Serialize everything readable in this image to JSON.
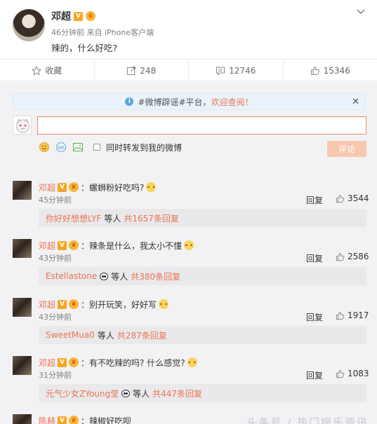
{
  "post": {
    "author": "邓超",
    "meta": "46分钟前 来自 iPhone客户端",
    "text": "辣的，什么好吃?"
  },
  "actions": {
    "favorite_label": "收藏",
    "repost_count": "248",
    "comment_count": "12746",
    "like_count": "15346"
  },
  "notice": {
    "text": "#微博辟谣#平台，",
    "link": "欢迎查阅！"
  },
  "composer": {
    "checkbox_label": "同时转发到我的微博",
    "submit_label": "评论"
  },
  "comments": [
    {
      "author": "邓超",
      "text": "：螺蛳粉好吃吗?",
      "time": "45分钟前",
      "reply_label": "回复",
      "likes": "3544",
      "sub_name": "你好好想想LYF",
      "sub_mid": "等人",
      "sub_count": "共1657条回复",
      "panda": false
    },
    {
      "author": "邓超",
      "text": "：辣条是什么，我太小不懂",
      "time": "43分钟前",
      "reply_label": "回复",
      "likes": "2586",
      "sub_name": "Estellastone",
      "sub_mid": "等人",
      "sub_count": "共380条回复",
      "panda": true
    },
    {
      "author": "邓超",
      "text": "：别开玩笑，好好写",
      "time": "43分钟前",
      "reply_label": "回复",
      "likes": "1917",
      "sub_name": "SweetMua0",
      "sub_mid": "等人",
      "sub_count": "共287条回复",
      "panda": false
    },
    {
      "author": "邓超",
      "text": "：有不吃辣的吗? 什么感觉?",
      "time": "31分钟前",
      "reply_label": "回复",
      "likes": "1083",
      "sub_name": "元气少女ZYoung莹",
      "sub_mid": "等人",
      "sub_count": "共447条回复",
      "panda": true
    },
    {
      "author": "陈赫",
      "text": "：辣椒好吃呗"
    }
  ],
  "watermark": "头条号 / 热门娱乐资讯"
}
